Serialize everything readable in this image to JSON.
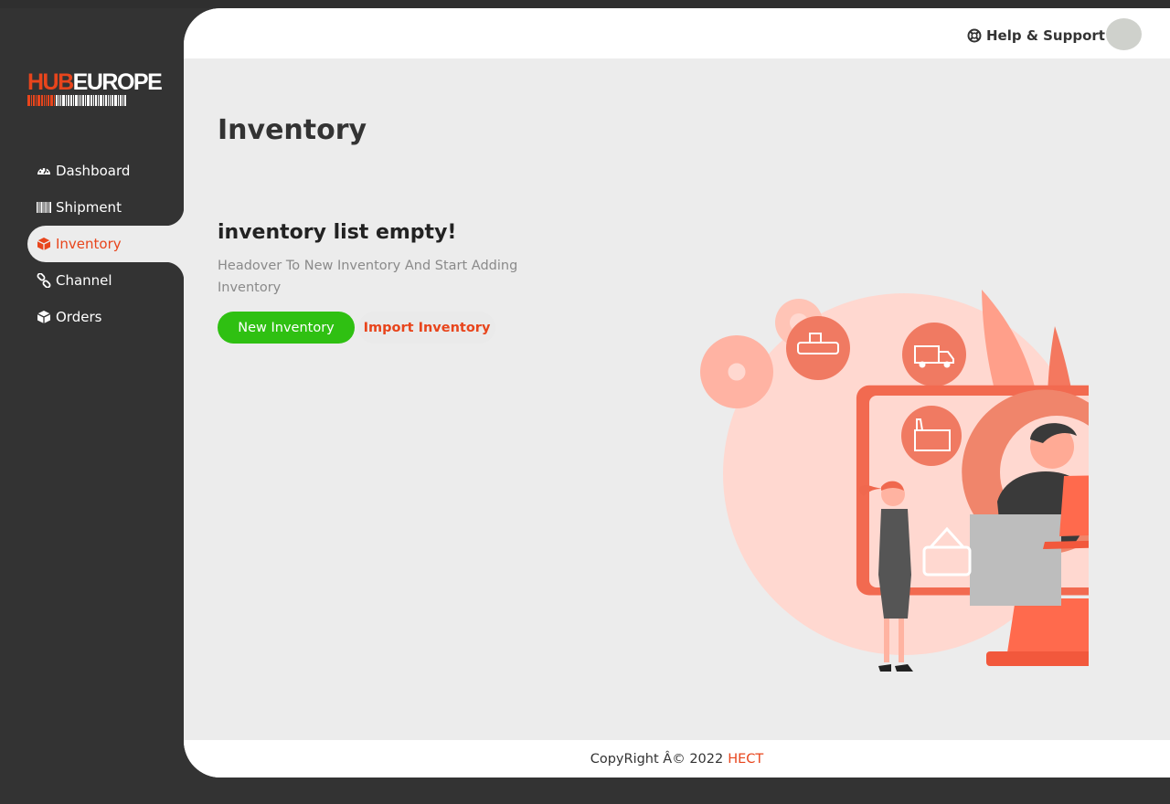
{
  "brand": {
    "logo_part1": "HUB",
    "logo_part2": "EUROPE",
    "accent_color": "#e8451c"
  },
  "sidebar": {
    "items": [
      {
        "label": "Dashboard",
        "icon": "dashboard-gauge-icon",
        "active": false
      },
      {
        "label": "Shipment",
        "icon": "barcode-icon",
        "active": false
      },
      {
        "label": "Inventory",
        "icon": "cube-icon",
        "active": true
      },
      {
        "label": "Channel",
        "icon": "link-icon",
        "active": false
      },
      {
        "label": "Orders",
        "icon": "box-icon",
        "active": false
      }
    ]
  },
  "header": {
    "help_label": "Help & Support",
    "help_icon": "life-ring-icon",
    "avatar": "user-avatar"
  },
  "main": {
    "page_title": "Inventory",
    "empty_title": "inventory list empty!",
    "empty_description": "Headover To New Inventory And Start Adding Inventory",
    "new_button_label": "New Inventory",
    "import_button_label": "Import Inventory",
    "new_button_color": "#2fc012",
    "illustration": "logistics-support-illustration"
  },
  "footer": {
    "copyright_text": "CopyRight Â© 2022",
    "brand_link": "HECT"
  }
}
